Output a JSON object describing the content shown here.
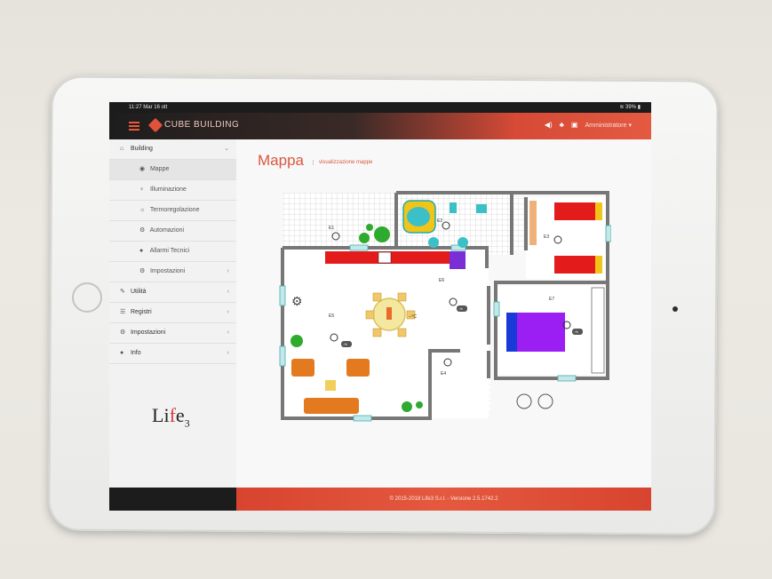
{
  "status_bar": {
    "time": "11:27 Mar 16 ott",
    "battery": "39%"
  },
  "header": {
    "brand": "CUBE BUILDING",
    "user": "Amministratore"
  },
  "sidebar": {
    "items": [
      {
        "label": "Building",
        "icon": "home-icon",
        "chevron": "⌄"
      },
      {
        "label": "Mappe",
        "icon": "globe-icon"
      },
      {
        "label": "Illuminazione",
        "icon": "bulb-icon"
      },
      {
        "label": "Termoregolazione",
        "icon": "sun-icon"
      },
      {
        "label": "Automazioni",
        "icon": "cogs-icon"
      },
      {
        "label": "Allarmi Tecnici",
        "icon": "alert-icon"
      },
      {
        "label": "Impostazioni",
        "icon": "cogs-icon",
        "chevron": "‹"
      },
      {
        "label": "Utilità",
        "icon": "wrench-icon",
        "chevron": "‹"
      },
      {
        "label": "Registri",
        "icon": "list-icon",
        "chevron": "‹"
      },
      {
        "label": "Impostazioni",
        "icon": "cogs-icon",
        "chevron": "‹"
      },
      {
        "label": "Info",
        "icon": "info-icon",
        "chevron": "‹"
      }
    ],
    "logo": {
      "l": "Li",
      "f": "f",
      "e": "e",
      "sub": "3"
    }
  },
  "main": {
    "title": "Mappa",
    "subtitle": "visualizzazione mappe"
  },
  "map": {
    "rooms": [
      "E1",
      "E2",
      "E3",
      "E4",
      "E5",
      "E6",
      "E7"
    ],
    "temperature": "--°C",
    "dimmer": "-%"
  },
  "footer": "© 2015-2018 Life3 S.r.l. - Versione 2.5.1742.2",
  "colors": {
    "accent": "#e0533a",
    "sidebar_bg": "#f2f2f2"
  }
}
